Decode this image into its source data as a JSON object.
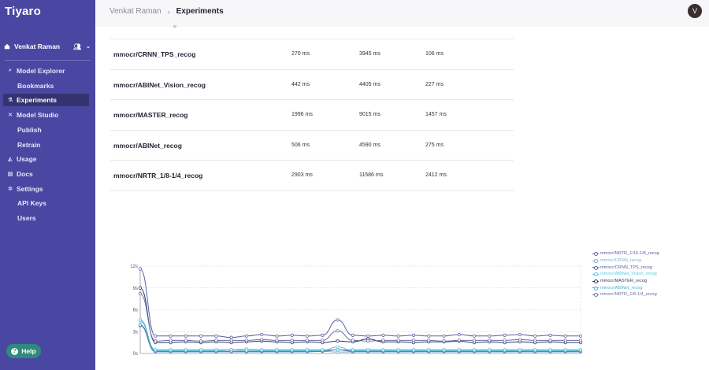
{
  "app": {
    "title": "Tiyaro"
  },
  "user": {
    "name": "Venkat Raman",
    "avatar_initial": "V"
  },
  "breadcrumb": {
    "user": "Venkat Raman",
    "separator": "›",
    "page": "Experiments"
  },
  "sidebar": {
    "items": [
      {
        "label": "Model Explorer",
        "icon": "search-icon",
        "glyph": "⌕",
        "sub": false,
        "active": false
      },
      {
        "label": "Bookmarks",
        "sub": true,
        "active": false
      },
      {
        "label": "Experiments",
        "icon": "flask-icon",
        "glyph": "⚗",
        "sub": false,
        "active": true
      },
      {
        "label": "Model Studio",
        "icon": "tools-icon",
        "glyph": "✕",
        "sub": false,
        "active": false
      },
      {
        "label": "Publish",
        "sub": true,
        "active": false
      },
      {
        "label": "Retrain",
        "sub": true,
        "active": false
      },
      {
        "label": "Usage",
        "icon": "chart-icon",
        "glyph": "◭",
        "sub": false,
        "active": false
      },
      {
        "label": "Docs",
        "icon": "doc-icon",
        "glyph": "▤",
        "sub": false,
        "active": false
      },
      {
        "label": "Settings",
        "icon": "gear-icon",
        "glyph": "✲",
        "sub": false,
        "active": false
      },
      {
        "label": "API Keys",
        "sub": true,
        "active": false
      },
      {
        "label": "Users",
        "sub": true,
        "active": false
      }
    ],
    "help_label": "Help"
  },
  "table": {
    "rows": [
      {
        "model": "mmocr/CRNN_TPS_recog",
        "v1": "270 ms",
        "v2": "3945 ms",
        "v3": "106 ms"
      },
      {
        "model": "mmocr/ABINet_Vision_recog",
        "v1": "442 ms",
        "v2": "4405 ms",
        "v3": "227 ms"
      },
      {
        "model": "mmocr/MASTER_recog",
        "v1": "1996 ms",
        "v2": "9015 ms",
        "v3": "1457 ms"
      },
      {
        "model": "mmocr/ABINet_recog",
        "v1": "506 ms",
        "v2": "4590 ms",
        "v3": "275 ms"
      },
      {
        "model": "mmocr/NRTR_1/8-1/4_recog",
        "v1": "2903 ms",
        "v2": "11586 ms",
        "v3": "2412 ms"
      }
    ]
  },
  "colors": {
    "sidebar": "#4a47a3",
    "active": "#34336f",
    "help": "#2e8a7c"
  },
  "chart_data": {
    "type": "line",
    "x_count": 30,
    "ylim": [
      0,
      12
    ],
    "y_ticks": [
      "12s",
      "9s",
      "6s",
      "3s",
      "0s"
    ],
    "y_tick_values": [
      12,
      9,
      6,
      3,
      0
    ],
    "grid": true,
    "legend_position": "right",
    "series": [
      {
        "name": "mmocr/NRTR_1/16-1/8_recog",
        "color": "#5a5fa6",
        "values": [
          11.6,
          2.4,
          2.4,
          2.4,
          2.4,
          2.4,
          2.2,
          2.4,
          2.6,
          2.4,
          2.5,
          2.4,
          2.5,
          4.6,
          2.5,
          2.4,
          2.5,
          2.4,
          2.5,
          2.4,
          2.4,
          2.6,
          2.4,
          2.4,
          2.5,
          2.6,
          2.4,
          2.5,
          2.4,
          2.4
        ]
      },
      {
        "name": "mmocr/CRNN_recog",
        "color": "#7fb0d8",
        "values": [
          3.8,
          0.2,
          0.2,
          0.2,
          0.2,
          0.2,
          0.2,
          0.2,
          0.2,
          0.2,
          0.2,
          0.2,
          0.3,
          0.2,
          0.2,
          0.2,
          0.2,
          0.2,
          0.2,
          0.2,
          0.2,
          0.2,
          0.2,
          0.2,
          0.2,
          0.2,
          0.2,
          0.2,
          0.2,
          0.2
        ]
      },
      {
        "name": "mmocr/CRNN_TPS_recog",
        "color": "#5a62a6",
        "values": [
          3.9,
          0.3,
          0.3,
          0.3,
          0.3,
          0.3,
          0.3,
          0.3,
          0.3,
          0.3,
          0.3,
          0.3,
          0.3,
          0.5,
          0.3,
          0.3,
          0.3,
          0.3,
          0.3,
          0.3,
          0.3,
          0.3,
          0.3,
          0.3,
          0.3,
          0.3,
          0.3,
          0.3,
          0.3,
          0.3
        ]
      },
      {
        "name": "mmocr/ABINet_Vision_recog",
        "color": "#5cc7e0",
        "values": [
          4.4,
          0.4,
          0.4,
          0.4,
          0.4,
          0.4,
          0.5,
          0.4,
          0.4,
          0.4,
          0.4,
          0.4,
          0.4,
          0.9,
          0.4,
          0.4,
          0.4,
          0.4,
          0.4,
          0.4,
          0.4,
          0.4,
          0.4,
          0.4,
          0.4,
          0.4,
          0.4,
          0.4,
          0.4,
          0.4
        ]
      },
      {
        "name": "mmocr/MASTER_recog",
        "color": "#2e3675",
        "values": [
          9.0,
          1.5,
          1.5,
          1.6,
          1.5,
          1.6,
          1.5,
          1.6,
          1.7,
          1.6,
          1.5,
          1.6,
          1.5,
          1.7,
          1.6,
          2.0,
          1.6,
          1.6,
          1.5,
          1.6,
          1.6,
          1.7,
          1.5,
          1.6,
          1.5,
          1.6,
          1.5,
          1.6,
          1.5,
          1.5
        ]
      },
      {
        "name": "mmocr/ABINet_recog",
        "color": "#4aaed0",
        "values": [
          4.6,
          0.5,
          0.5,
          0.5,
          0.5,
          0.5,
          0.5,
          0.6,
          0.5,
          0.5,
          0.5,
          0.5,
          0.5,
          0.5,
          0.5,
          0.5,
          0.5,
          0.5,
          0.5,
          0.5,
          0.5,
          0.5,
          0.5,
          0.5,
          0.5,
          0.5,
          0.5,
          0.5,
          0.5,
          0.5
        ]
      },
      {
        "name": "mmocr/NRTR_1/8-1/4_recog",
        "color": "#6b6f9e",
        "values": [
          8.2,
          1.7,
          1.8,
          1.8,
          1.7,
          1.8,
          1.8,
          1.8,
          1.9,
          1.8,
          1.8,
          1.8,
          1.8,
          3.1,
          1.8,
          1.7,
          1.8,
          1.8,
          1.8,
          1.8,
          1.7,
          1.8,
          1.8,
          1.8,
          1.8,
          1.9,
          1.8,
          1.8,
          1.8,
          1.8
        ]
      }
    ]
  }
}
